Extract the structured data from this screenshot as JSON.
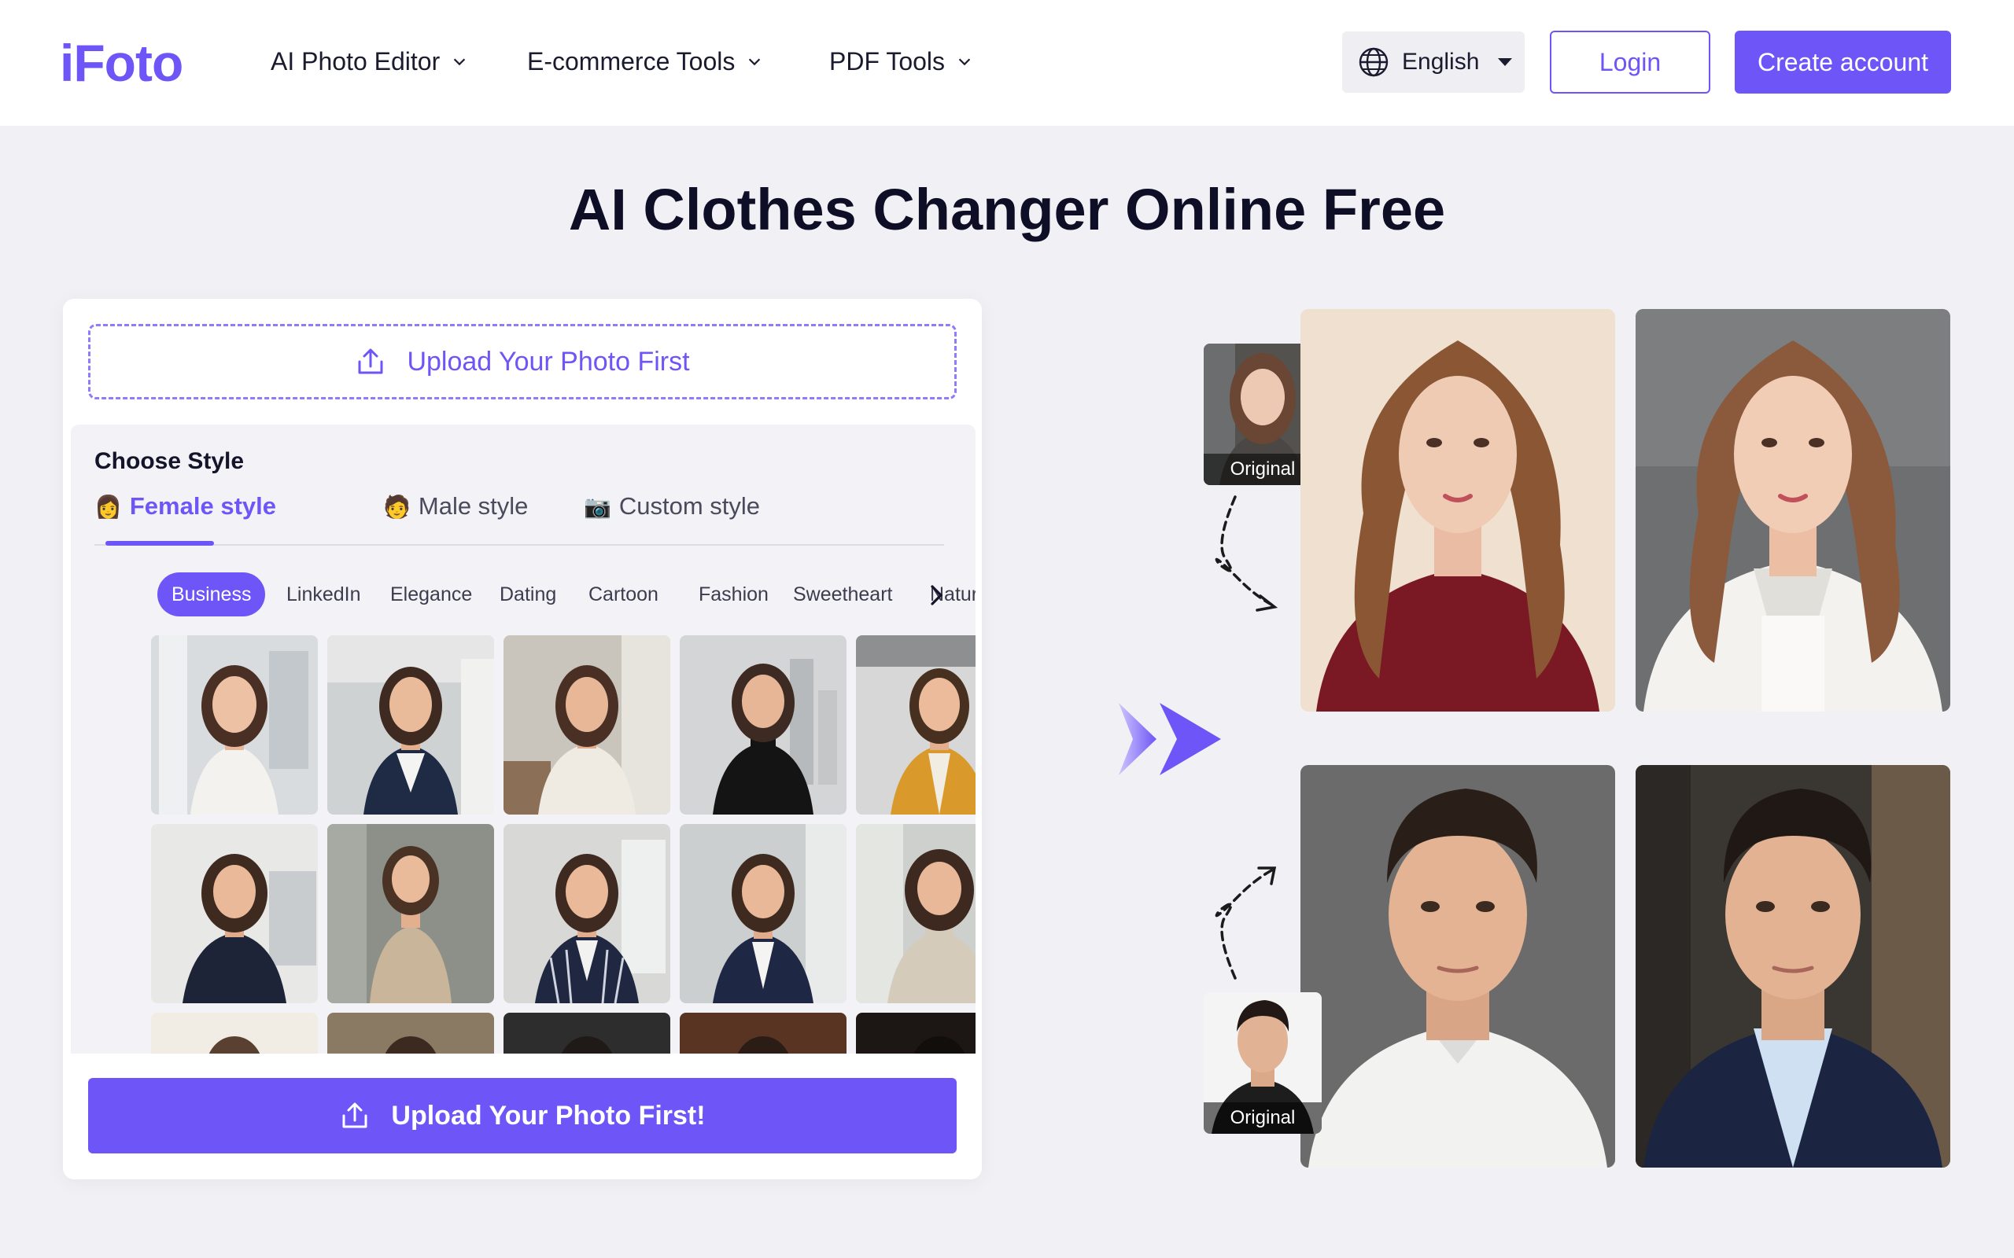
{
  "header": {
    "logo": "iFoto",
    "nav": [
      {
        "label": "AI Photo Editor"
      },
      {
        "label": "E-commerce Tools"
      },
      {
        "label": "PDF Tools"
      }
    ],
    "language": "English",
    "login": "Login",
    "create_account": "Create account"
  },
  "page_title": "AI Clothes Changer Online Free",
  "panel": {
    "upload_top": "Upload Your Photo First",
    "choose_style": "Choose Style",
    "tabs": [
      {
        "emoji": "👩",
        "label": "Female style"
      },
      {
        "emoji": "🧑",
        "label": "Male style"
      },
      {
        "emoji": "📷",
        "label": "Custom style"
      }
    ],
    "categories": [
      "Business",
      "LinkedIn",
      "Elegance",
      "Dating",
      "Cartoon",
      "Fashion",
      "Sweetheart",
      "Nature"
    ],
    "upload_bottom": "Upload Your Photo First!"
  },
  "showcase": {
    "original_label_1": "Original",
    "original_label_2": "Original"
  },
  "colors": {
    "accent": "#6d55f7",
    "background": "#f1f1f5"
  }
}
